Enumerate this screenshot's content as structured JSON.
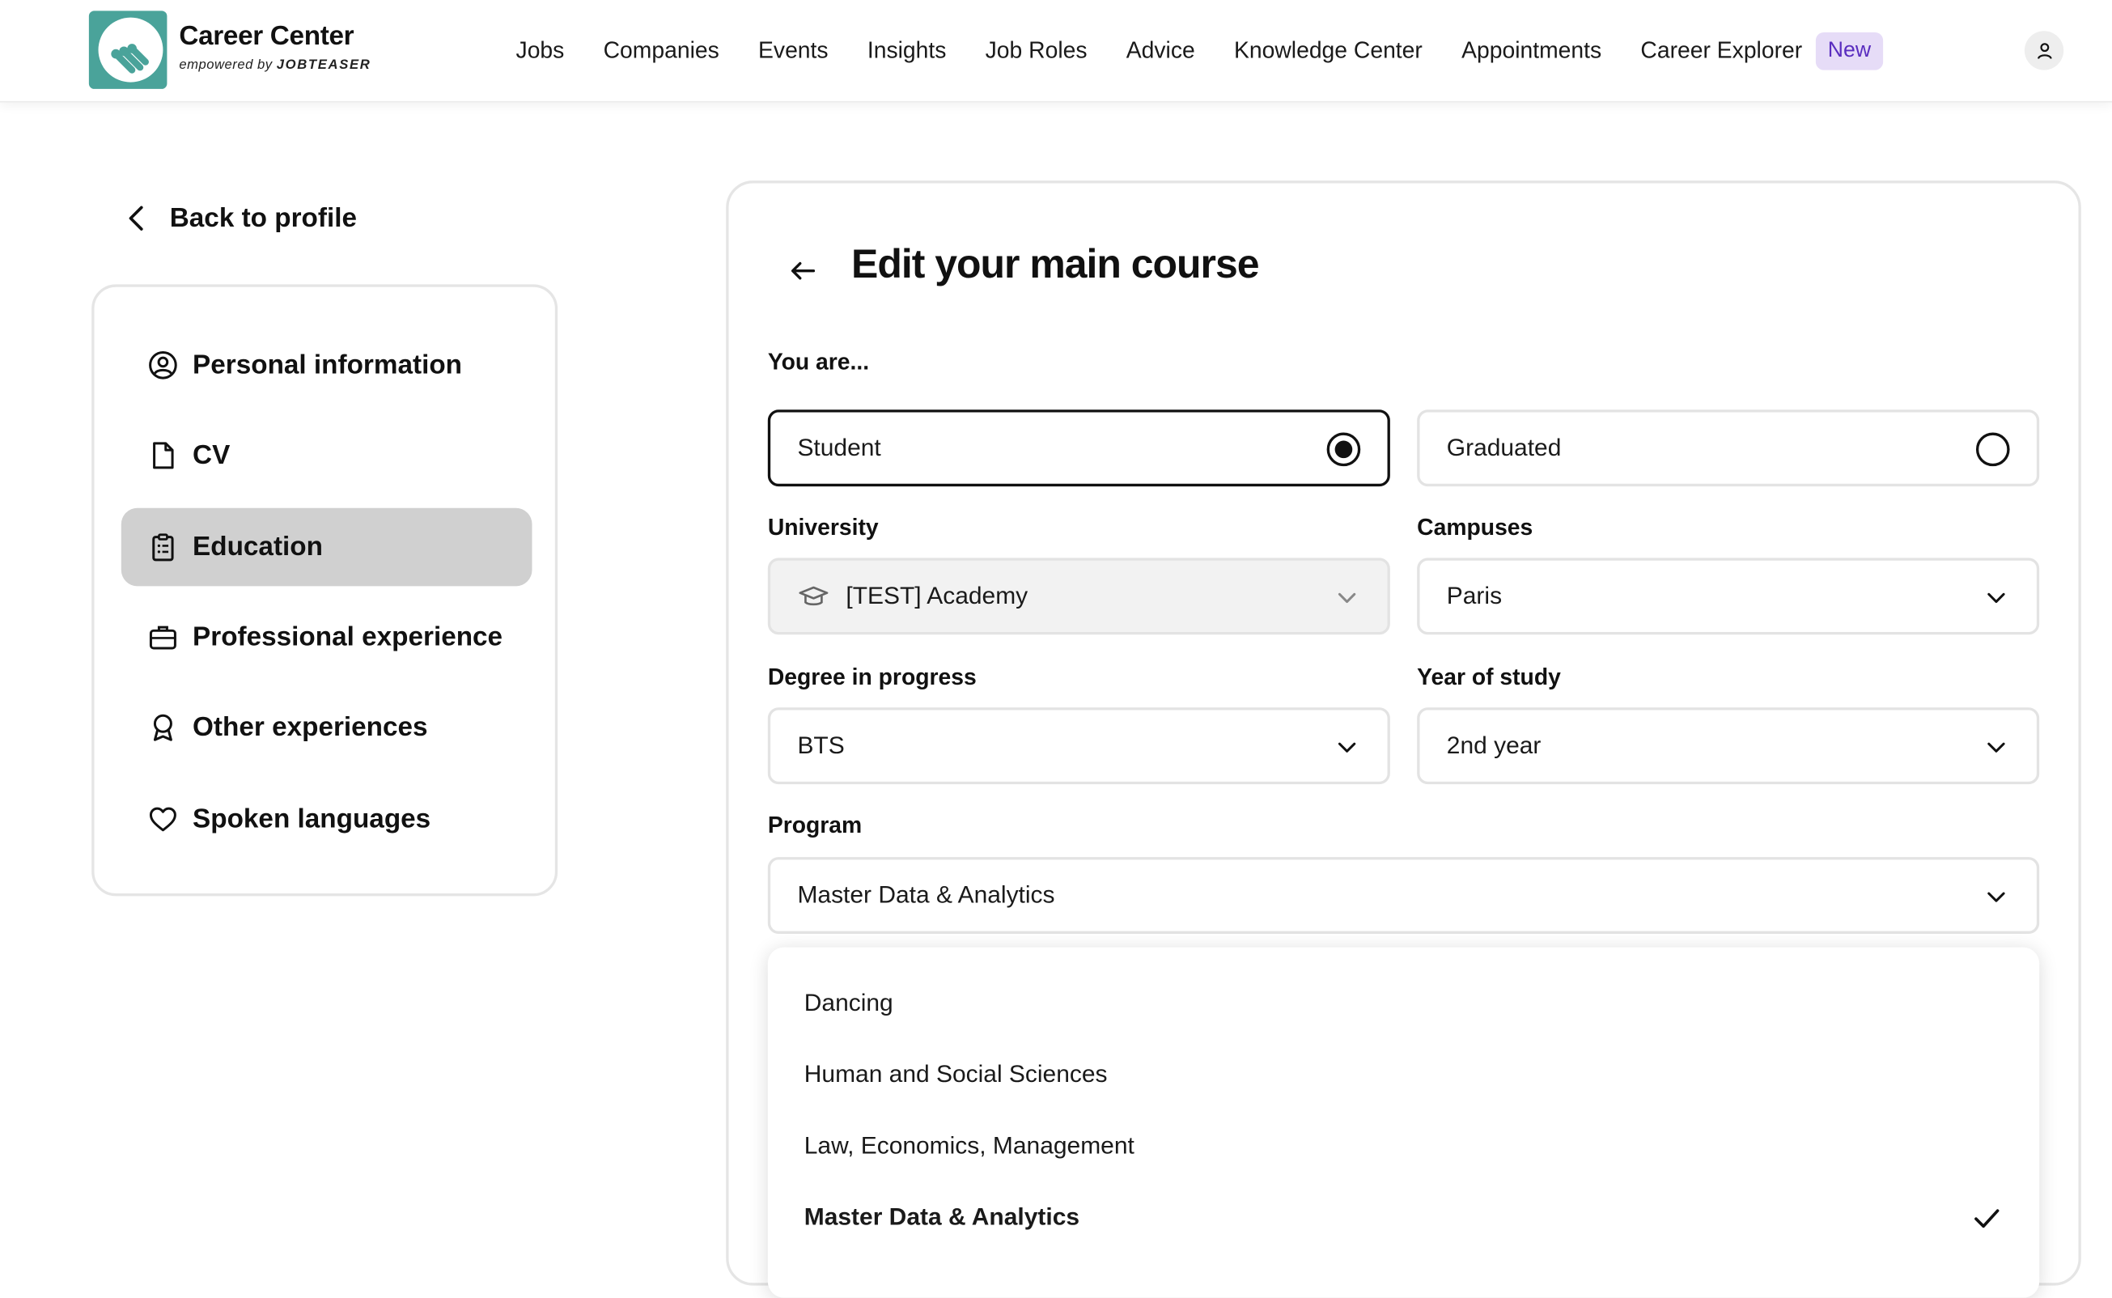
{
  "header": {
    "brand_name": "Career Center",
    "brand_sub_prefix": "empowered by ",
    "brand_sub_strong": "JOBTEASER",
    "nav": [
      "Jobs",
      "Companies",
      "Events",
      "Insights",
      "Job Roles",
      "Advice",
      "Knowledge Center",
      "Appointments",
      "Career Explorer"
    ],
    "new_badge": "New"
  },
  "sidebar": {
    "back_label": "Back to profile",
    "items": [
      {
        "label": "Personal information",
        "icon": "user-circle-icon"
      },
      {
        "label": "CV",
        "icon": "document-icon"
      },
      {
        "label": "Education",
        "icon": "clipboard-icon",
        "active": true
      },
      {
        "label": "Professional experience",
        "icon": "briefcase-icon"
      },
      {
        "label": "Other experiences",
        "icon": "award-icon"
      },
      {
        "label": "Spoken languages",
        "icon": "heart-icon"
      }
    ]
  },
  "form": {
    "title": "Edit your main course",
    "you_are_label": "You are...",
    "status_options": [
      {
        "label": "Student",
        "selected": true
      },
      {
        "label": "Graduated",
        "selected": false
      }
    ],
    "university_label": "University",
    "university_value": "[TEST] Academy",
    "campuses_label": "Campuses",
    "campuses_value": "Paris",
    "degree_label": "Degree in progress",
    "degree_value": "BTS",
    "year_label": "Year of study",
    "year_value": "2nd year",
    "program_label": "Program",
    "program_value": "Master Data & Analytics",
    "program_options": [
      {
        "label": "Dancing",
        "selected": false
      },
      {
        "label": "Human and Social Sciences",
        "selected": false
      },
      {
        "label": "Law, Economics, Management",
        "selected": false
      },
      {
        "label": "Master Data & Analytics",
        "selected": true
      }
    ]
  },
  "colors": {
    "logo_bg": "#4aa39a",
    "badge_bg": "#e6dcf7",
    "badge_text": "#5a2dbf",
    "active_nav": "#d0d0d0"
  }
}
